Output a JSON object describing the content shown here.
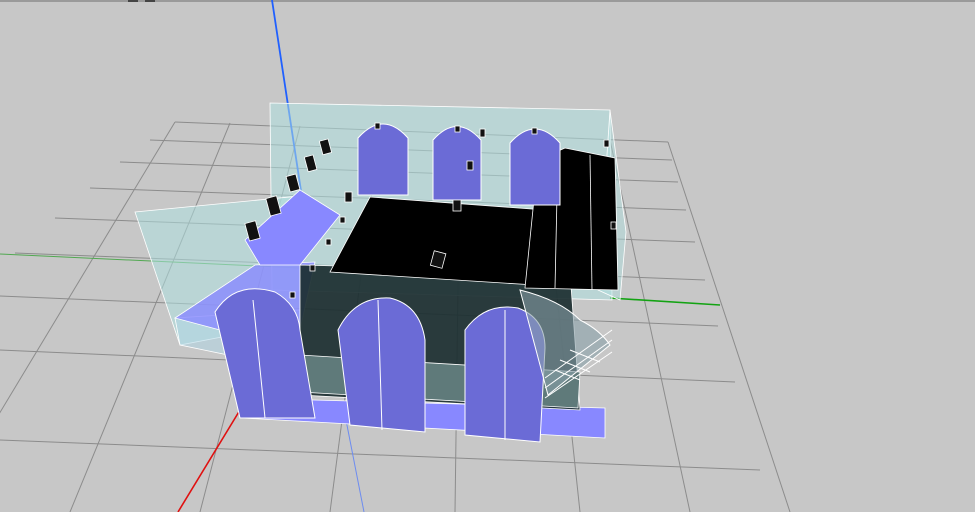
{
  "viewport": {
    "background": "#c7c7c7",
    "grid_color": "#8c8c8c",
    "axes": {
      "x_color": "#e01010",
      "y_color": "#13a313",
      "z_color": "#2060ff"
    }
  },
  "model": {
    "window_fill": "#6b6bd6",
    "wall_fill": "#aee0e0",
    "roof_fill": "#000000",
    "floor_fill": "#8888ff",
    "edge_color": "#ffffff"
  },
  "toolbar": {
    "icons": [
      "toolbar-icon-1",
      "toolbar-icon-2"
    ]
  }
}
